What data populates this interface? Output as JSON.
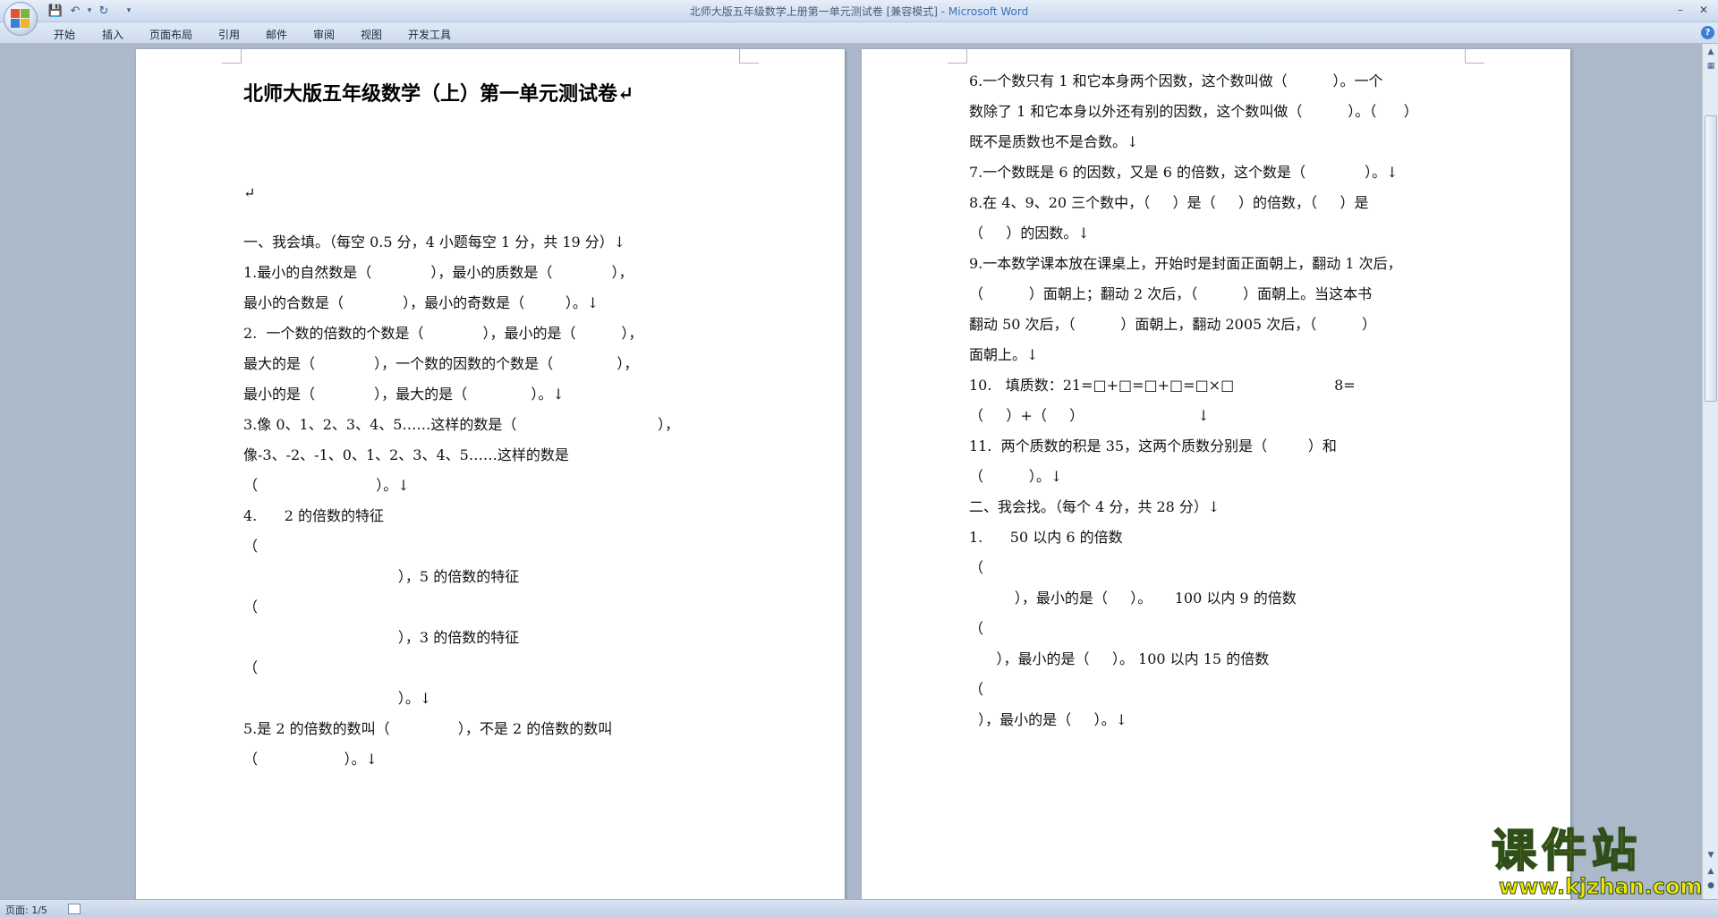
{
  "window": {
    "title": "北师大版五年级数学上册第一单元测试卷 [兼容模式] - ",
    "app": "Microsoft Word",
    "minimize_icon": "minimize-icon",
    "restore_icon": "restore-icon",
    "close_icon": "close-icon"
  },
  "ribbon": {
    "tabs": [
      "开始",
      "插入",
      "页面布局",
      "引用",
      "邮件",
      "审阅",
      "视图",
      "开发工具"
    ]
  },
  "document": {
    "title": "北师大版五年级数学（上）第一单元测试卷↵",
    "left_lines": [
      "↵",
      "一、我会填。（每空 0.5 分，4 小题每空 1 分，共 19 分）↓",
      "1.最小的自然数是（             ），最小的质数是（             ），",
      "最小的合数是（             ），最小的奇数是（         ）。↓",
      "2.  一个数的倍数的个数是（             ），最小的是（          ），",
      "最大的是（             ），一个数的因数的个数是（              ），",
      "最小的是（             ），最大的是（              ）。↓",
      "3.像 0、1、2、3、4、5……这样的数是（                               ），",
      "像-3、-2、-1、0、1、2、3、4、5……这样的数是",
      "（                          ）。↓",
      "4.      2 的倍数的特征",
      "（",
      "                                  ），5 的倍数的特征",
      "（",
      "                                  ），3 的倍数的特征",
      "（",
      "                                  ）。↓",
      "5.是 2 的倍数的数叫（               ），不是 2 的倍数的数叫",
      "（                   ）。↓"
    ],
    "right_lines": [
      "6.一个数只有 1 和它本身两个因数，这个数叫做（          ）。一个",
      "数除了 1 和它本身以外还有别的因数，这个数叫做（          ）。（      ）",
      "既不是质数也不是合数。↓",
      "7.一个数既是 6 的因数，又是 6 的倍数，这个数是（             ）。↓",
      "8.在 4、9、20 三个数中，（     ）是（     ）的倍数，（     ）是",
      "（     ）的因数。↓",
      "9.一本数学课本放在课桌上，开始时是封面正面朝上，翻动 1 次后，",
      "（          ）面朝上；翻动 2 次后，（          ）面朝上。当这本书",
      "翻动 50 次后，（          ）面朝上，翻动 2005 次后，（          ）",
      "面朝上。↓",
      "10.   填质数：21=□+□=□+□=□×□                      8=",
      "（     ）+（     ）                         ↓",
      "11.  两个质数的积是 35，这两个质数分别是（         ）和",
      "（          ）。↓",
      "二、我会找。（每个 4 分，共 28 分）↓",
      "1.      50 以内 6 的倍数",
      "（",
      "          ），最小的是（     ）。     100 以内 9 的倍数",
      "（",
      "      ），最小的是（     ）。 100 以内 15 的倍数",
      "（",
      "  ），最小的是（     ）。↓"
    ]
  },
  "statusbar": {
    "page_info": "页面: 1/5"
  },
  "watermark": {
    "title": "课件站",
    "url": "www.kjzhan.com"
  },
  "colors": {
    "accent": "#3d6fb8",
    "watermark_fill": "#f2e500"
  }
}
